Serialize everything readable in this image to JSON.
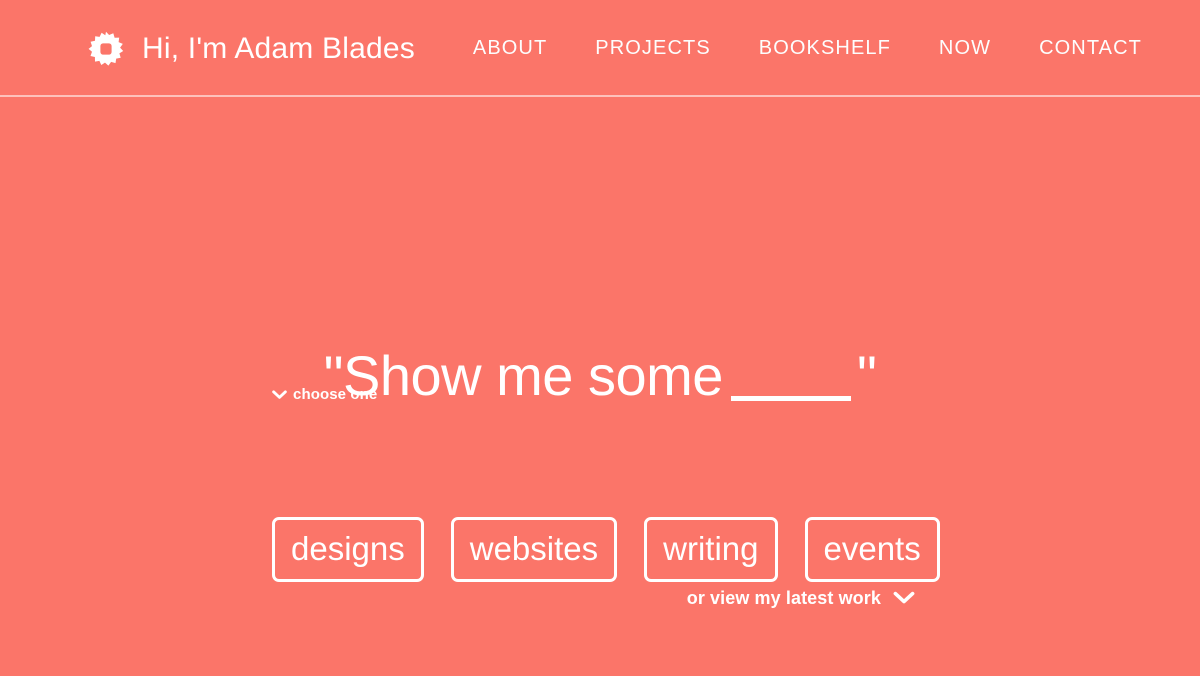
{
  "theme": {
    "background": "#fb7569",
    "foreground": "#ffffff",
    "divider": "rgba(255,255,255,0.55)"
  },
  "header": {
    "logo_icon": "sunburst-logo-icon",
    "brand_title": "Hi, I'm Adam Blades",
    "nav": [
      {
        "label": "ABOUT"
      },
      {
        "label": "PROJECTS"
      },
      {
        "label": "BOOKSHELF"
      },
      {
        "label": "NOW"
      },
      {
        "label": "CONTACT"
      }
    ]
  },
  "hero": {
    "headline_prefix": "\"Show me some",
    "headline_blank": "______",
    "headline_suffix": "\"",
    "choose_icon": "chevron-down-icon",
    "choose_label": "choose one",
    "options": [
      {
        "label": "designs"
      },
      {
        "label": "websites"
      },
      {
        "label": "writing"
      },
      {
        "label": "events"
      }
    ],
    "latest_link_label": "or view my latest work",
    "latest_icon": "chevron-down-icon"
  }
}
